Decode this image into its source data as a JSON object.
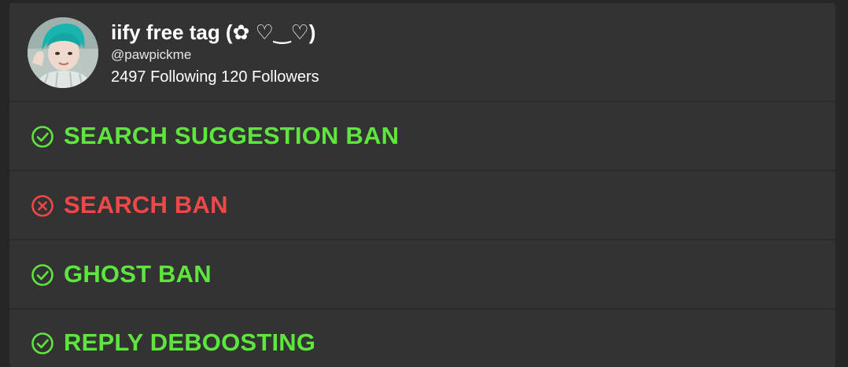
{
  "profile": {
    "name": "iify free tag (✿ ♡‿♡)",
    "handle": "@pawpickme",
    "following_count": "2497",
    "following_label": "Following",
    "followers_count": "120",
    "followers_label": "Followers"
  },
  "checks": [
    {
      "label": "SEARCH SUGGESTION BAN",
      "status": "pass",
      "icon": "check-circle-icon",
      "color": "#5ee63f"
    },
    {
      "label": "SEARCH BAN",
      "status": "fail",
      "icon": "x-circle-icon",
      "color": "#f04848"
    },
    {
      "label": "GHOST BAN",
      "status": "pass",
      "icon": "check-circle-icon",
      "color": "#5ee63f"
    },
    {
      "label": "REPLY DEBOOSTING",
      "status": "pass",
      "icon": "check-circle-icon",
      "color": "#5ee63f"
    }
  ]
}
